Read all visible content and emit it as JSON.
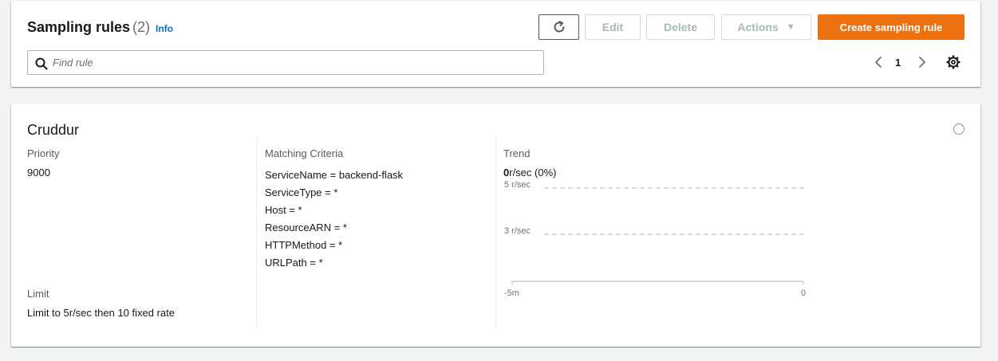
{
  "header": {
    "title": "Sampling rules",
    "count": "(2)",
    "info": "Info"
  },
  "toolbar": {
    "edit_label": "Edit",
    "delete_label": "Delete",
    "actions_label": "Actions",
    "create_label": "Create sampling rule"
  },
  "search": {
    "placeholder": "Find rule",
    "value": ""
  },
  "pagination": {
    "page": "1"
  },
  "rule": {
    "name": "Cruddur",
    "priority_label": "Priority",
    "priority_value": "9000",
    "limit_label": "Limit",
    "limit_value": "Limit to 5r/sec then 10 fixed rate",
    "criteria_label": "Matching Criteria",
    "criteria": [
      "ServiceName = backend-flask",
      "ServiceType = *",
      "Host = *",
      "ResourceARN = *",
      "HTTPMethod = *",
      "URLPath = *"
    ],
    "trend_label": "Trend",
    "trend_value_bold": "0",
    "trend_value_rest": "r/sec (0%)",
    "trend_chart": {
      "y_ticks": [
        "5 r/sec",
        "3 r/sec"
      ],
      "x_ticks": [
        "-5m",
        "0"
      ]
    }
  },
  "colors": {
    "accent": "#ec7211",
    "link": "#0073bb",
    "disabled_text": "#aab7b8"
  },
  "icons": [
    "refresh-icon",
    "search-icon",
    "chevron-left-icon",
    "chevron-right-icon",
    "gear-icon",
    "caret-down-icon"
  ]
}
